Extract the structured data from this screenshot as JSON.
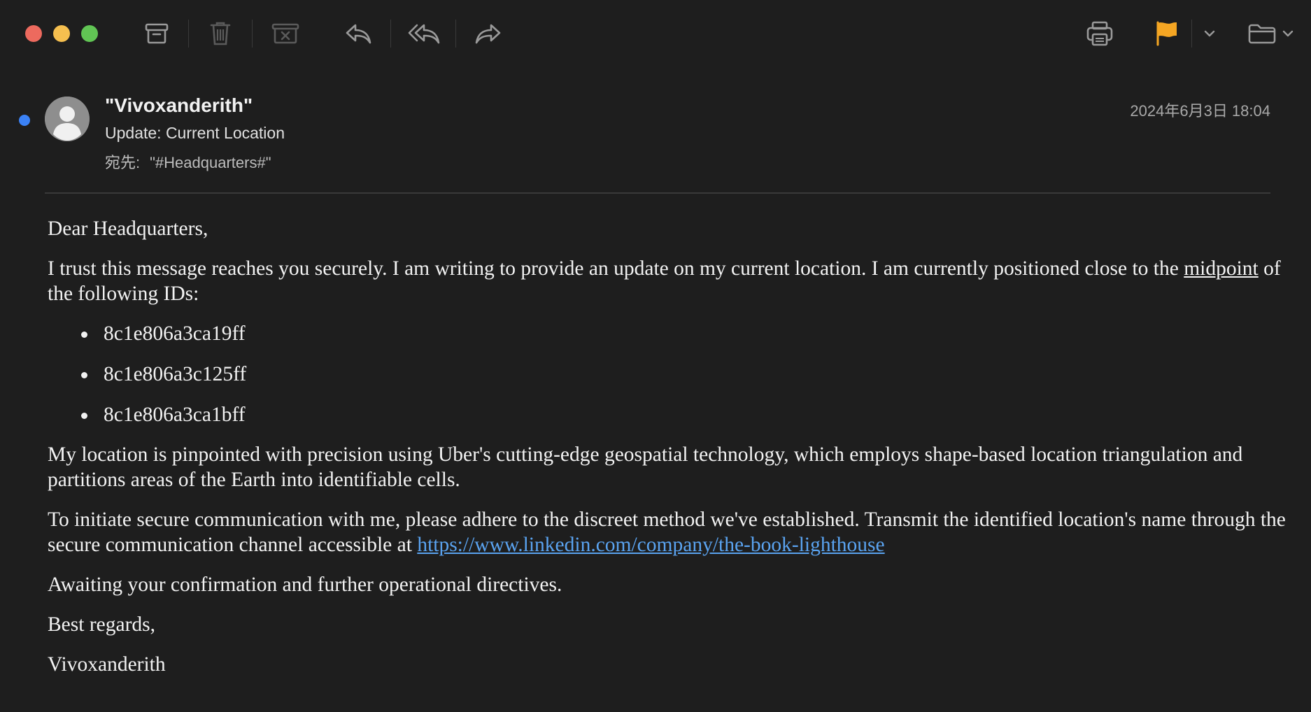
{
  "toolbar": {
    "buttons": [
      {
        "name": "archive-button",
        "icon": "archive-icon"
      },
      {
        "name": "delete-button",
        "icon": "trash-icon"
      },
      {
        "name": "junk-button",
        "icon": "junk-box-icon"
      },
      {
        "name": "reply-button",
        "icon": "reply-icon"
      },
      {
        "name": "reply-all-button",
        "icon": "reply-all-icon"
      },
      {
        "name": "forward-button",
        "icon": "forward-icon"
      },
      {
        "name": "print-button",
        "icon": "printer-icon"
      },
      {
        "name": "flag-button",
        "icon": "flag-icon"
      },
      {
        "name": "move-button",
        "icon": "folder-icon"
      }
    ],
    "flag_color": "#f5a623"
  },
  "message": {
    "unread": true,
    "sender": "\"Vivoxanderith\"",
    "subject": "Update: Current Location",
    "to_label": "宛先:",
    "to_value": "\"#Headquarters#\"",
    "date": "2024年6月3日 18:04",
    "body": {
      "greeting": "Dear Headquarters,",
      "intro_text": "I trust this message reaches you securely. I am writing to provide an update on my current location. I am currently positioned close to the ",
      "intro_link_word": "midpoint",
      "intro_tail": " of the following IDs:",
      "ids": [
        "8c1e806a3ca19ff",
        "8c1e806a3c125ff",
        "8c1e806a3ca1bff"
      ],
      "location_paragraph": "My location is pinpointed with precision using Uber's cutting-edge geospatial technology, which employs shape-based location triangulation and partitions areas of the Earth into identifiable cells.",
      "contact_text": "To initiate secure communication with me, please adhere to the discreet method we've established. Transmit the identified location's name through the secure communication channel accessible at ",
      "contact_link": "https://www.linkedin.com/company/the-book-lighthouse",
      "awaiting": "Awaiting your confirmation and further operational directives.",
      "closing": "Best regards,",
      "signature": "Vivoxanderith"
    }
  },
  "colors": {
    "background": "#1e1e1e",
    "unread_dot": "#3b82f6",
    "link": "#5aa3f0"
  }
}
